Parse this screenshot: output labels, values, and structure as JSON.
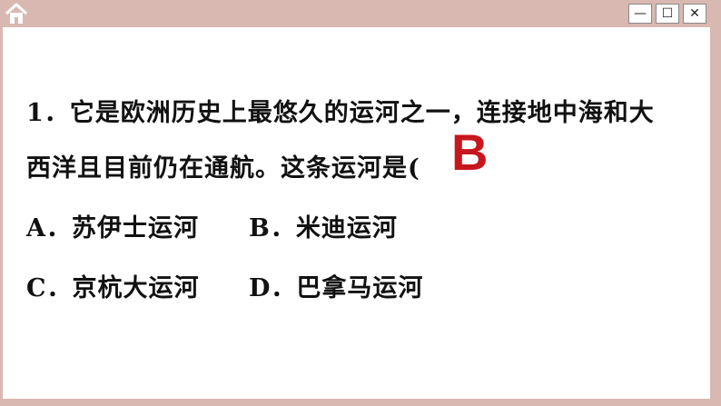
{
  "window": {
    "home_icon": "home-icon",
    "controls": {
      "minimize": "—",
      "maximize": "☐",
      "close": "✕"
    }
  },
  "question": {
    "line1": "1．它是欧洲历史上最悠久的运河之一，连接地中海和大",
    "line2": "西洋且目前仍在通航。这条运河是(",
    "answer": "B",
    "answer_color": "#c8161d"
  },
  "options": {
    "a": "A．苏伊士运河",
    "b": "B．米迪运河",
    "c": "C．京杭大运河",
    "d": "D．巴拿马运河"
  }
}
